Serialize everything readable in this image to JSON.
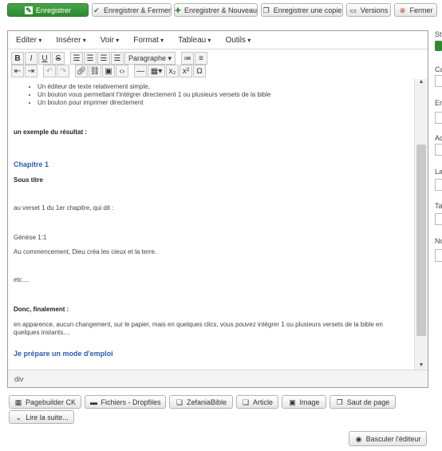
{
  "toolbar": {
    "save": "Enregistrer",
    "save_close": "Enregistrer & Fermer",
    "save_new": "Enregistrer & Nouveau",
    "save_copy": "Enregistrer une copie",
    "versions": "Versions",
    "close": "Fermer"
  },
  "menubar": [
    "Editer",
    "Insérer",
    "Voir",
    "Format",
    "Tableau",
    "Outils"
  ],
  "format_select": "Paragraphe",
  "content": {
    "bullets": [
      "Un éditeur de texte relativement simple,",
      "Un bouton vous permettant t'intégrer directement 1 ou plusieurs versets de la bible",
      "Un bouton pour imprimer directement"
    ],
    "example_heading": "un exemple du résultat :",
    "chapter": "Chapitre 1",
    "subtitle": "Sous titre",
    "verse_intro": "au verset 1 du 1er chapitre, qui dit :",
    "reference": "Génèse 1:1",
    "verse_text": "Au commencement, Dieu créa les cieux et la terre.",
    "etc": "etc....",
    "final_heading": "Donc, finalement :",
    "final_text": "en apparence, aucun changement, sur le papier, mais en quelques clics, vous pouvez intégrer 1 ou plusieurs versets de la bible en quelques instants....",
    "cut_heading": "Je prépare un mode d'emploi"
  },
  "status_path": "div",
  "editor_buttons": [
    "Pagebuilder CK",
    "Fichiers - Dropfiles",
    "ZefaniaBible",
    "Article",
    "Image",
    "Saut de page",
    "Lire la suite..."
  ],
  "toggle_editor": "Basculer l'éditeur",
  "side_labels": [
    "St",
    "Ca",
    "Er",
    "Ac",
    "La",
    "Ta",
    "No"
  ]
}
